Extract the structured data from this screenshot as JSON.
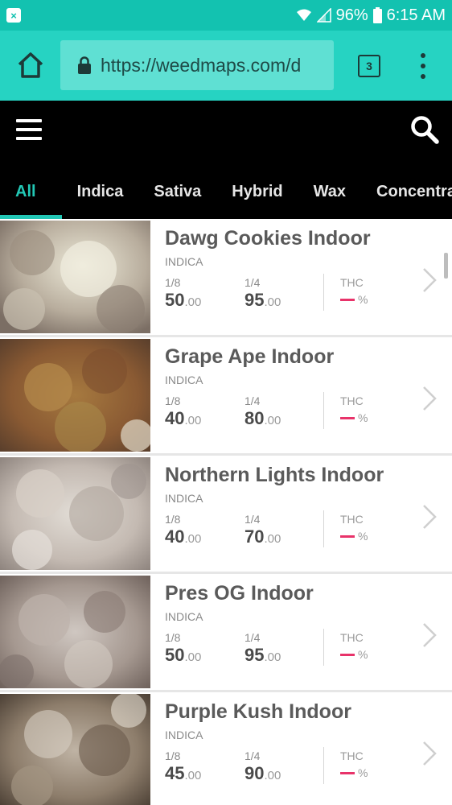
{
  "status_bar": {
    "battery": "96%",
    "time": "6:15 AM",
    "icons": [
      "notification-x-icon",
      "wifi-icon",
      "signal-icon",
      "battery-icon"
    ]
  },
  "browser": {
    "url": "https://weedmaps.com/d",
    "tab_count": "3",
    "icons": [
      "home-icon",
      "lock-icon",
      "tabs-icon",
      "overflow-menu-icon"
    ]
  },
  "site": {
    "icons": [
      "hamburger-menu-icon",
      "search-icon"
    ],
    "categories": [
      {
        "label": "All",
        "active": true
      },
      {
        "label": "Indica",
        "active": false
      },
      {
        "label": "Sativa",
        "active": false
      },
      {
        "label": "Hybrid",
        "active": false
      },
      {
        "label": "Wax",
        "active": false
      },
      {
        "label": "Concentrates",
        "active": false
      }
    ]
  },
  "products": [
    {
      "name": "Dawg Cookies Indoor",
      "type": "INDICA",
      "size1": "1/8",
      "price1": "50",
      "cents1": ".00",
      "size2": "1/4",
      "price2": "95",
      "cents2": ".00",
      "thc_label": "THC",
      "thc_unit": "%"
    },
    {
      "name": "Grape Ape Indoor",
      "type": "INDICA",
      "size1": "1/8",
      "price1": "40",
      "cents1": ".00",
      "size2": "1/4",
      "price2": "80",
      "cents2": ".00",
      "thc_label": "THC",
      "thc_unit": "%"
    },
    {
      "name": "Northern Lights Indoor",
      "type": "INDICA",
      "size1": "1/8",
      "price1": "40",
      "cents1": ".00",
      "size2": "1/4",
      "price2": "70",
      "cents2": ".00",
      "thc_label": "THC",
      "thc_unit": "%"
    },
    {
      "name": "Pres OG Indoor",
      "type": "INDICA",
      "size1": "1/8",
      "price1": "50",
      "cents1": ".00",
      "size2": "1/4",
      "price2": "95",
      "cents2": ".00",
      "thc_label": "THC",
      "thc_unit": "%"
    },
    {
      "name": "Purple Kush Indoor",
      "type": "INDICA",
      "size1": "1/8",
      "price1": "45",
      "cents1": ".00",
      "size2": "1/4",
      "price2": "90",
      "cents2": ".00",
      "thc_label": "THC",
      "thc_unit": "%"
    }
  ],
  "colors": {
    "status_bar": "#13c2b0",
    "url_bar": "#26d3c2",
    "accent": "#22c7b5",
    "header": "#000000",
    "thc_dash": "#e8336a"
  }
}
